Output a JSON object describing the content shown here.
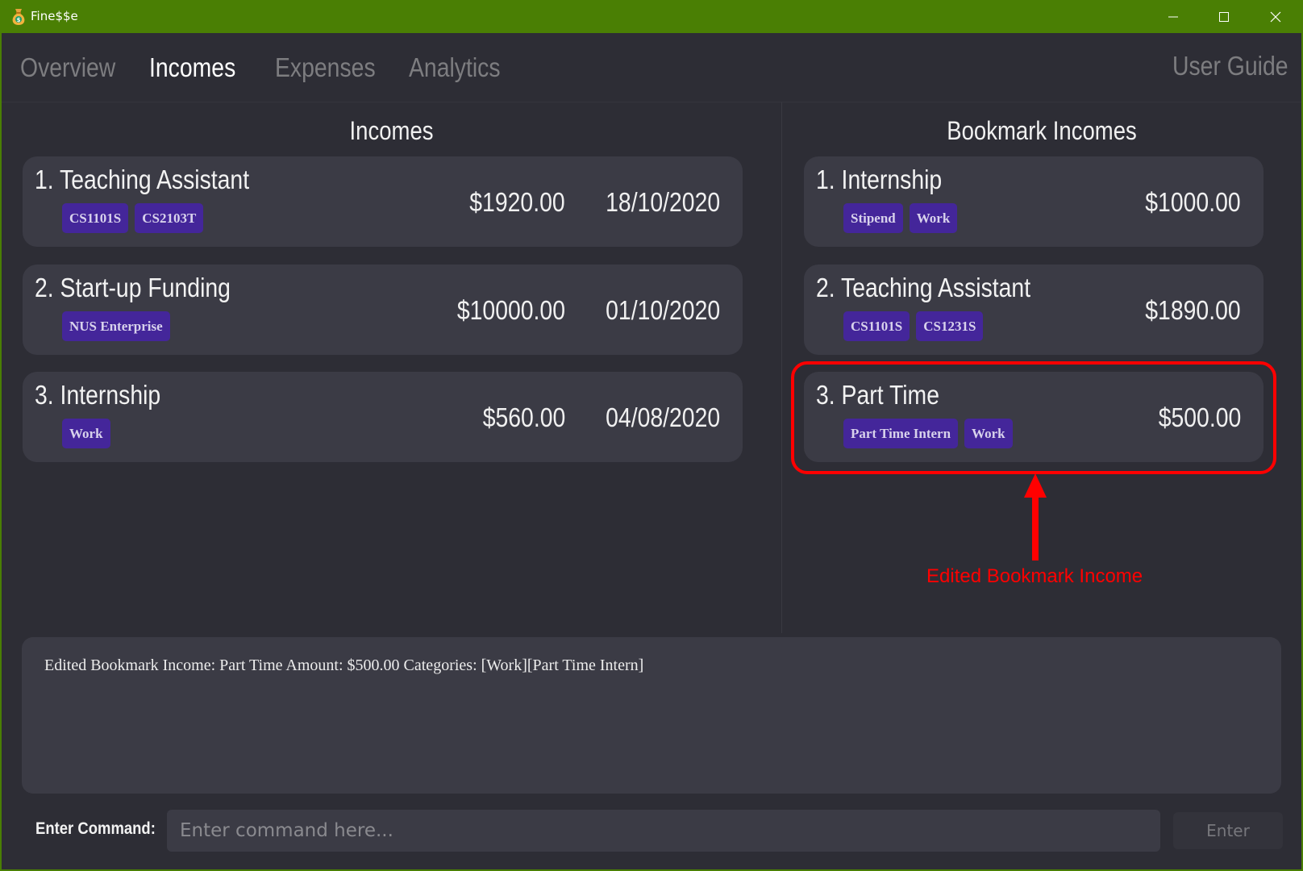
{
  "window": {
    "title": "Fine$$e",
    "icon": "money-bag-icon",
    "controls": [
      "minimize-icon",
      "maximize-icon",
      "close-icon"
    ],
    "title_bar_color": "#4a7f04"
  },
  "tabs": [
    {
      "label": "Overview",
      "active": false
    },
    {
      "label": "Incomes",
      "active": true
    },
    {
      "label": "Expenses",
      "active": false
    },
    {
      "label": "Analytics",
      "active": false
    }
  ],
  "user_guide_label": "User Guide",
  "incomes_panel": {
    "title": "Incomes",
    "items": [
      {
        "title": "1. Teaching Assistant",
        "tags": [
          "CS1101S",
          "CS2103T"
        ],
        "amount": "$1920.00",
        "date": "18/10/2020"
      },
      {
        "title": "2. Start-up Funding",
        "tags": [
          "NUS Enterprise"
        ],
        "amount": "$10000.00",
        "date": "01/10/2020"
      },
      {
        "title": "3. Internship",
        "tags": [
          "Work"
        ],
        "amount": "$560.00",
        "date": "04/08/2020"
      }
    ]
  },
  "bookmark_panel": {
    "title": "Bookmark Incomes",
    "items": [
      {
        "title": "1. Internship",
        "tags": [
          "Stipend",
          "Work"
        ],
        "amount": "$1000.00"
      },
      {
        "title": "2. Teaching Assistant",
        "tags": [
          "CS1101S",
          "CS1231S"
        ],
        "amount": "$1890.00"
      },
      {
        "title": "3. Part Time",
        "tags": [
          "Part Time Intern",
          "Work"
        ],
        "amount": "$500.00"
      }
    ]
  },
  "annotation": {
    "label": "Edited Bookmark Income",
    "color": "#ff0000"
  },
  "result_display": {
    "text": "Edited Bookmark Income: Part Time Amount: $500.00 Categories: [Work][Part Time Intern]"
  },
  "command": {
    "label": "Enter Command:",
    "value": "",
    "placeholder": "Enter command here...",
    "button_label": "Enter"
  },
  "colors": {
    "tag_bg": "#44269a",
    "card_bg": "#3b3b45",
    "page_bg": "#2d2d35"
  }
}
